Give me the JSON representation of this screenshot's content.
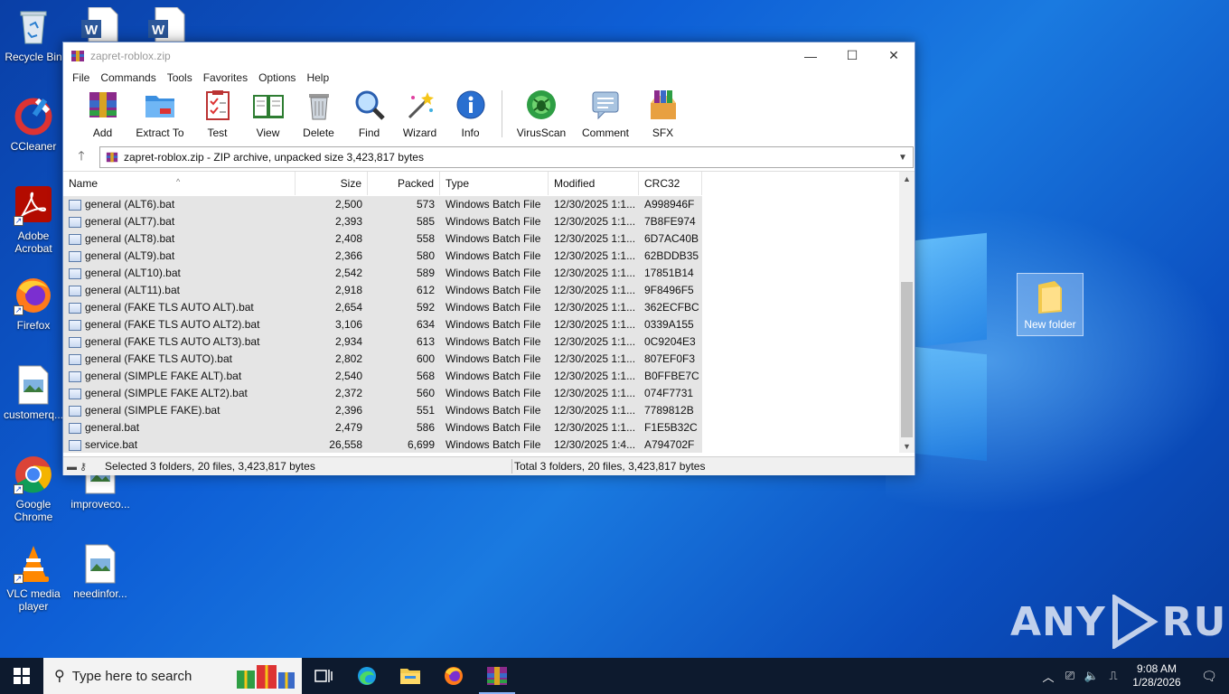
{
  "desktop": {
    "icons": [
      {
        "label": "Recycle Bin",
        "icon": "recycle-bin-icon"
      },
      {
        "label": "CCleaner",
        "icon": "ccleaner-icon"
      },
      {
        "label": "Adobe Acrobat",
        "icon": "acrobat-icon"
      },
      {
        "label": "Firefox",
        "icon": "firefox-icon"
      },
      {
        "label": "customerq...",
        "icon": "image-file-icon"
      },
      {
        "label": "Google Chrome",
        "icon": "chrome-icon"
      },
      {
        "label": "improveco...",
        "icon": "image-file-icon"
      },
      {
        "label": "VLC media player",
        "icon": "vlc-icon"
      },
      {
        "label": "needinfor...",
        "icon": "image-file-icon"
      }
    ],
    "new_folder_label": "New folder",
    "watermark": "ANY RUN"
  },
  "window": {
    "title": "zapret-roblox.zip",
    "menu": [
      "File",
      "Commands",
      "Tools",
      "Favorites",
      "Options",
      "Help"
    ],
    "toolbar": [
      {
        "label": "Add",
        "icon": "add-archive-icon"
      },
      {
        "label": "Extract To",
        "icon": "extract-folder-icon"
      },
      {
        "label": "Test",
        "icon": "test-clipboard-icon"
      },
      {
        "label": "View",
        "icon": "view-book-icon"
      },
      {
        "label": "Delete",
        "icon": "trash-icon"
      },
      {
        "label": "Find",
        "icon": "magnifier-icon"
      },
      {
        "label": "Wizard",
        "icon": "wizard-wand-icon"
      },
      {
        "label": "Info",
        "icon": "info-icon"
      },
      {
        "label": "VirusScan",
        "icon": "virus-scan-icon"
      },
      {
        "label": "Comment",
        "icon": "comment-icon"
      },
      {
        "label": "SFX",
        "icon": "sfx-icon"
      }
    ],
    "path": "zapret-roblox.zip - ZIP archive, unpacked size 3,423,817 bytes",
    "columns": {
      "name": "Name",
      "size": "Size",
      "packed": "Packed",
      "type": "Type",
      "modified": "Modified",
      "crc": "CRC32"
    },
    "files": [
      {
        "name": "general (ALT6).bat",
        "size": "2,500",
        "packed": "573",
        "type": "Windows Batch File",
        "modified": "12/30/2025 1:1...",
        "crc": "A998946F"
      },
      {
        "name": "general (ALT7).bat",
        "size": "2,393",
        "packed": "585",
        "type": "Windows Batch File",
        "modified": "12/30/2025 1:1...",
        "crc": "7B8FE974"
      },
      {
        "name": "general (ALT8).bat",
        "size": "2,408",
        "packed": "558",
        "type": "Windows Batch File",
        "modified": "12/30/2025 1:1...",
        "crc": "6D7AC40B"
      },
      {
        "name": "general (ALT9).bat",
        "size": "2,366",
        "packed": "580",
        "type": "Windows Batch File",
        "modified": "12/30/2025 1:1...",
        "crc": "62BDDB35"
      },
      {
        "name": "general (ALT10).bat",
        "size": "2,542",
        "packed": "589",
        "type": "Windows Batch File",
        "modified": "12/30/2025 1:1...",
        "crc": "17851B14"
      },
      {
        "name": "general (ALT11).bat",
        "size": "2,918",
        "packed": "612",
        "type": "Windows Batch File",
        "modified": "12/30/2025 1:1...",
        "crc": "9F8496F5"
      },
      {
        "name": "general (FAKE TLS AUTO ALT).bat",
        "size": "2,654",
        "packed": "592",
        "type": "Windows Batch File",
        "modified": "12/30/2025 1:1...",
        "crc": "362ECFBC"
      },
      {
        "name": "general (FAKE TLS AUTO ALT2).bat",
        "size": "3,106",
        "packed": "634",
        "type": "Windows Batch File",
        "modified": "12/30/2025 1:1...",
        "crc": "0339A155"
      },
      {
        "name": "general (FAKE TLS AUTO ALT3).bat",
        "size": "2,934",
        "packed": "613",
        "type": "Windows Batch File",
        "modified": "12/30/2025 1:1...",
        "crc": "0C9204E3"
      },
      {
        "name": "general (FAKE TLS AUTO).bat",
        "size": "2,802",
        "packed": "600",
        "type": "Windows Batch File",
        "modified": "12/30/2025 1:1...",
        "crc": "807EF0F3"
      },
      {
        "name": "general (SIMPLE FAKE ALT).bat",
        "size": "2,540",
        "packed": "568",
        "type": "Windows Batch File",
        "modified": "12/30/2025 1:1...",
        "crc": "B0FFBE7C"
      },
      {
        "name": "general (SIMPLE FAKE ALT2).bat",
        "size": "2,372",
        "packed": "560",
        "type": "Windows Batch File",
        "modified": "12/30/2025 1:1...",
        "crc": "074F7731"
      },
      {
        "name": "general (SIMPLE FAKE).bat",
        "size": "2,396",
        "packed": "551",
        "type": "Windows Batch File",
        "modified": "12/30/2025 1:1...",
        "crc": "7789812B"
      },
      {
        "name": "general.bat",
        "size": "2,479",
        "packed": "586",
        "type": "Windows Batch File",
        "modified": "12/30/2025 1:1...",
        "crc": "F1E5B32C"
      },
      {
        "name": "service.bat",
        "size": "26,558",
        "packed": "6,699",
        "type": "Windows Batch File",
        "modified": "12/30/2025 1:4...",
        "crc": "A794702F"
      }
    ],
    "status_left": "Selected 3 folders, 20 files, 3,423,817 bytes",
    "status_right": "Total 3 folders, 20 files, 3,423,817 bytes"
  },
  "taskbar": {
    "search_placeholder": "Type here to search",
    "time": "9:08 AM",
    "date": "1/28/2026"
  },
  "colors": {
    "accent": "#0e5fd6",
    "taskbar": "#0d1a2e",
    "selected_row": "#e5e5e5"
  }
}
